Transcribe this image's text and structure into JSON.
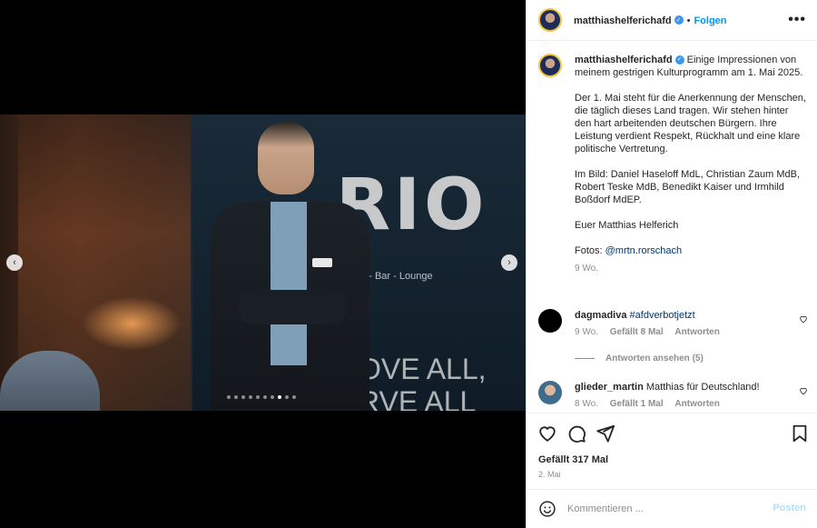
{
  "post": {
    "username": "matthiashelferichafd",
    "follow_label": "Folgen",
    "separator": "•",
    "more_label": "•••"
  },
  "carousel": {
    "photo_text_main": "RIO",
    "photo_text_sub": "aurant - Bar - Lounge",
    "photo_text_bottom_1": "OVE ALL,",
    "photo_text_bottom_2": "RVE ALL",
    "prev_label": "‹",
    "next_label": "›",
    "dots_total": 10,
    "active_dot": 8
  },
  "caption": {
    "username": "matthiashelferichafd",
    "intro": "Einige Impressionen von meinem gestrigen Kulturprogramm am 1. Mai 2025.",
    "para2": "Der 1. Mai steht für die Anerkennung der Menschen, die täglich dieses Land tragen. Wir stehen hinter den hart arbeitenden deutschen Bürgern. Ihre Leistung verdient Respekt, Rückhalt und eine klare politische Vertretung.",
    "para3": "Im Bild: Daniel Haseloff MdL, Christian Zaum MdB, Robert Teske MdB, Benedikt Kaiser und Irmhild Boßdorf MdEP.",
    "para4": "Euer Matthias Helferich",
    "photo_credit_prefix": "Fotos: ",
    "photo_credit_link": "@mrtn.rorschach",
    "time": "9 Wo."
  },
  "comments": [
    {
      "username": "dagmadiva",
      "text": "#afdverbotjetzt",
      "time": "9 Wo.",
      "likes": "Gefällt 8 Mal",
      "reply": "Antworten",
      "avatar_color": "#000000"
    },
    {
      "username": "glieder_martin",
      "text": "Matthias für Deutschland!",
      "time": "8 Wo.",
      "likes": "Gefällt 1 Mal",
      "reply": "Antworten",
      "avatar_color": "#3f6b8c"
    }
  ],
  "view_replies": "Antworten ansehen (5)",
  "actions": {
    "likes_text": "Gefällt 317 Mal",
    "date": "2. Mai"
  },
  "comment_box": {
    "placeholder": "Kommentieren ...",
    "post_label": "Posten"
  },
  "colors": {
    "accent": "#0095f6",
    "verified": "#3897f0",
    "muted": "#8e8e8e",
    "link": "#00376b"
  }
}
